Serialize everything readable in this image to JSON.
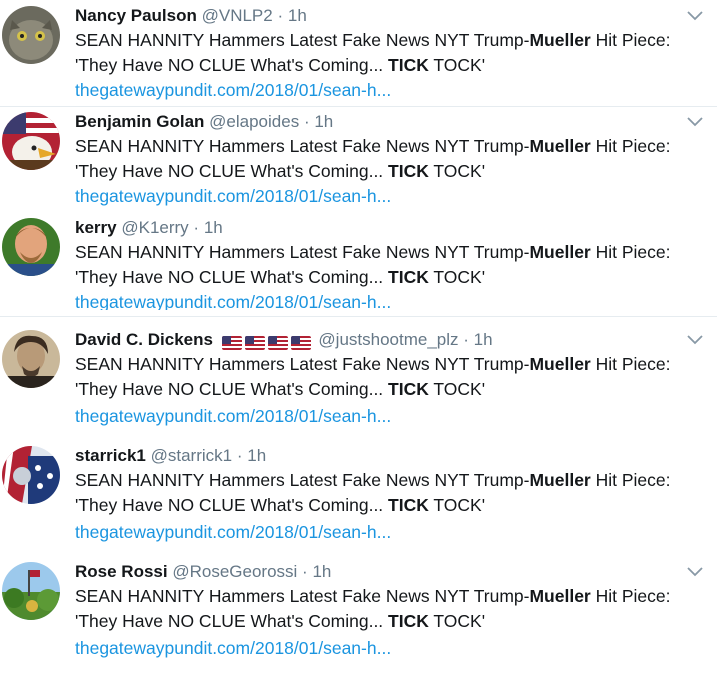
{
  "tweets": [
    {
      "name": "Nancy Paulson",
      "handle": "@VNLP2",
      "dot": "·",
      "time": "1h",
      "t1": "SEAN HANNITY Hammers Latest Fake News NYT Trump-",
      "t2": "Mueller",
      "t3": " Hit Piece: 'They Have NO CLUE What's Coming... ",
      "t4": "TICK",
      "t5": " TOCK'",
      "link": "thegatewaypundit.com/2018/01/sean-h..."
    },
    {
      "name": "Benjamin Golan",
      "handle": "@elapoides",
      "dot": "·",
      "time": "1h",
      "t1": "SEAN HANNITY Hammers Latest Fake News NYT Trump-",
      "t2": "Mueller",
      "t3": " Hit Piece: 'They Have NO CLUE What's Coming... ",
      "t4": "TICK",
      "t5": " TOCK'",
      "link": "thegatewaypundit.com/2018/01/sean-h..."
    },
    {
      "name": "kerry",
      "handle": "@K1erry",
      "dot": "·",
      "time": "1h",
      "t1": "SEAN HANNITY Hammers Latest Fake News NYT Trump-",
      "t2": "Mueller",
      "t3": " Hit Piece: 'They Have NO CLUE What's Coming... ",
      "t4": "TICK",
      "t5": " TOCK'",
      "link": "thegatewaypundit.com/2018/01/sean-h..."
    },
    {
      "name": "David C. Dickens",
      "handle": "@justshootme_plz",
      "dot": "·",
      "time": "1h",
      "t1": "SEAN HANNITY Hammers Latest Fake News NYT Trump-",
      "t2": "Mueller",
      "t3": " Hit Piece: 'They Have NO CLUE What's Coming... ",
      "t4": "TICK",
      "t5": " TOCK'",
      "link": "thegatewaypundit.com/2018/01/sean-h..."
    },
    {
      "name": "starrick1",
      "handle": "@starrick1",
      "dot": "·",
      "time": "1h",
      "t1": "SEAN HANNITY Hammers Latest Fake News NYT Trump-",
      "t2": "Mueller",
      "t3": " Hit Piece: 'They Have NO CLUE What's Coming... ",
      "t4": "TICK",
      "t5": " TOCK'",
      "link": "thegatewaypundit.com/2018/01/sean-h..."
    },
    {
      "name": "Rose Rossi",
      "handle": "@RoseGeorossi",
      "dot": "·",
      "time": "1h",
      "t1": "SEAN HANNITY Hammers Latest Fake News NYT Trump-",
      "t2": "Mueller",
      "t3": " Hit Piece: 'They Have NO CLUE What's Coming... ",
      "t4": "TICK",
      "t5": " TOCK'",
      "link": "thegatewaypundit.com/2018/01/sean-h..."
    }
  ],
  "colors": {
    "link": "#1b95e0",
    "muted": "#657786",
    "text": "#14171a",
    "divider": "#e6ecf0"
  },
  "icons": {
    "more": "chevron-down-icon",
    "flag": "us-flag-icon"
  }
}
